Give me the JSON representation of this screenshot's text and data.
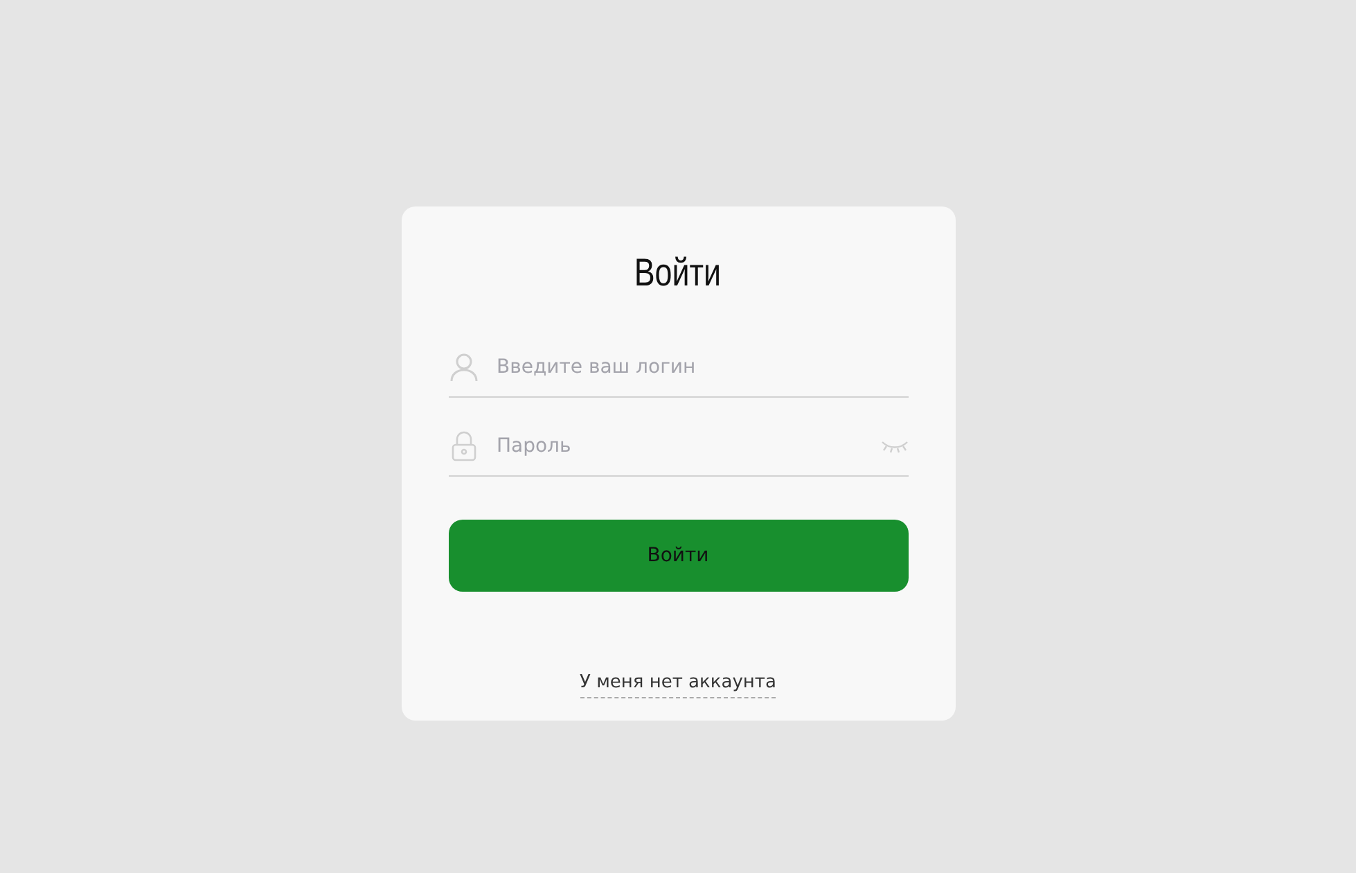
{
  "form": {
    "title": "Войти",
    "fields": [
      {
        "kind": "login",
        "placeholder": "Введите ваш логин"
      },
      {
        "kind": "password",
        "placeholder": "Пароль"
      }
    ],
    "submit": "Войти",
    "link": "У меня нет аккаунта"
  }
}
